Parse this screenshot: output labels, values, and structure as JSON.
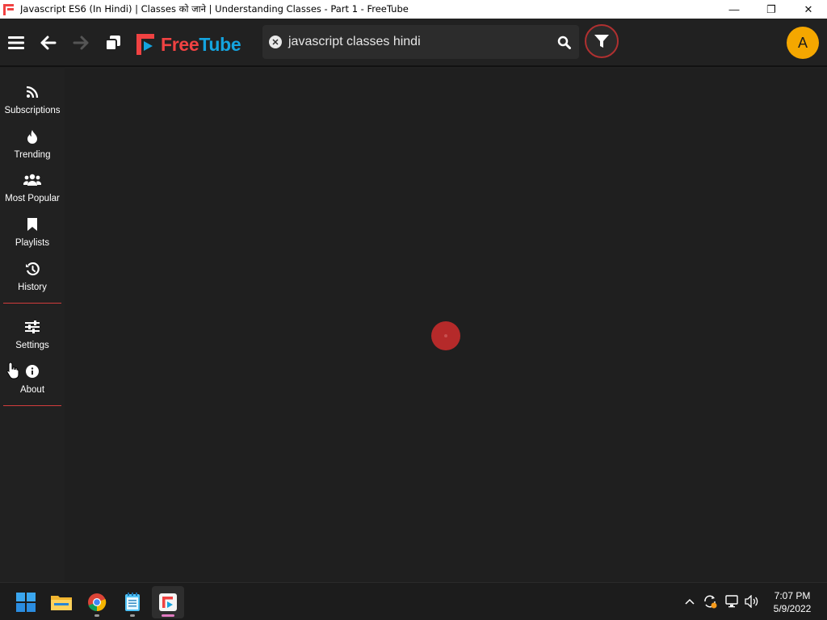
{
  "window": {
    "title": "Javascript ES6 (In Hindi) | Classes को जाने | Understanding Classes - Part 1 - FreeTube",
    "minimize_glyph": "—",
    "restore_glyph": "❐",
    "close_glyph": "✕"
  },
  "header": {
    "logo_free": "Free",
    "logo_tube": "Tube",
    "search": {
      "value": "javascript classes hindi"
    },
    "avatar_letter": "A"
  },
  "sidebar": {
    "items": [
      {
        "label": "Subscriptions",
        "icon": "rss-icon"
      },
      {
        "label": "Trending",
        "icon": "fire-icon"
      },
      {
        "label": "Most Popular",
        "icon": "users-icon"
      },
      {
        "label": "Playlists",
        "icon": "bookmark-icon"
      },
      {
        "label": "History",
        "icon": "history-icon"
      },
      {
        "label": "Settings",
        "icon": "sliders-icon"
      },
      {
        "label": "About",
        "icon": "info-icon"
      }
    ]
  },
  "taskbar": {
    "apps": [
      "start-icon",
      "file-explorer-icon",
      "chrome-icon",
      "notepad-icon",
      "freetube-icon"
    ],
    "tray": [
      "chevron-up-icon",
      "sync-icon",
      "network-icon",
      "volume-icon"
    ],
    "time": "7:07 PM",
    "date": "5/9/2022"
  },
  "colors": {
    "accent_red": "#f04242",
    "accent_blue": "#14a4df",
    "avatar": "#f5a700",
    "background": "#212121"
  }
}
